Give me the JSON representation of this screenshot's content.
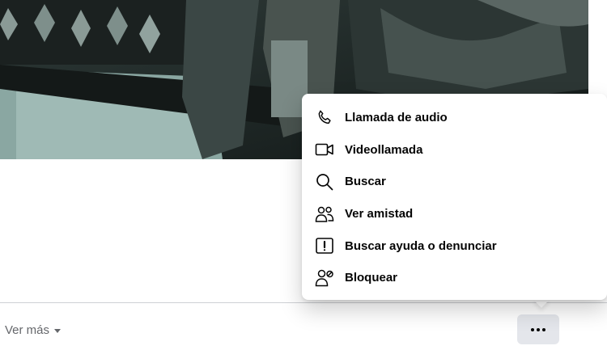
{
  "menu": {
    "items": [
      {
        "label": "Llamada de audio",
        "icon": "phone-icon"
      },
      {
        "label": "Videollamada",
        "icon": "video-camera-icon"
      },
      {
        "label": "Buscar",
        "icon": "search-icon"
      },
      {
        "label": "Ver amistad",
        "icon": "friends-icon"
      },
      {
        "label": "Buscar ayuda o denunciar",
        "icon": "report-icon"
      },
      {
        "label": "Bloquear",
        "icon": "block-user-icon"
      }
    ]
  },
  "footer": {
    "see_more_label": "Ver más",
    "more_button_icon": "more-dots-icon"
  },
  "colors": {
    "menu_bg": "#ffffff",
    "text": "#050505",
    "secondary_text": "#65676b",
    "button_bg": "#e4e6eb",
    "divider": "#ced0d4"
  }
}
